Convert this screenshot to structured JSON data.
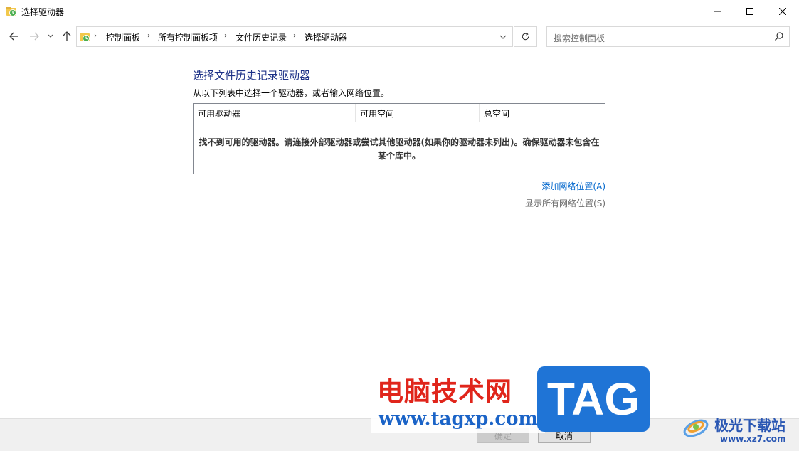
{
  "window": {
    "title": "选择驱动器"
  },
  "nav": {
    "breadcrumbs": [
      "控制面板",
      "所有控制面板项",
      "文件历史记录",
      "选择驱动器"
    ],
    "search_placeholder": "搜索控制面板"
  },
  "main": {
    "heading": "选择文件历史记录驱动器",
    "instruction": "从以下列表中选择一个驱动器，或者输入网络位置。",
    "columns": [
      "可用驱动器",
      "可用空间",
      "总空间"
    ],
    "empty_message": "找不到可用的驱动器。请连接外部驱动器或尝试其他驱动器(如果你的驱动器未列出)。确保驱动器未包含在某个库中。",
    "add_network_link": "添加网络位置(A)",
    "show_network_link": "显示所有网络位置(S)"
  },
  "footer": {
    "ok_label": "确定",
    "cancel_label": "取消"
  },
  "watermark": {
    "cn_text": "电脑技术网",
    "url": "www.tagxp.com",
    "tag": "TAG",
    "site_name": "极光下载站",
    "site_url": "www.xz7.com"
  }
}
